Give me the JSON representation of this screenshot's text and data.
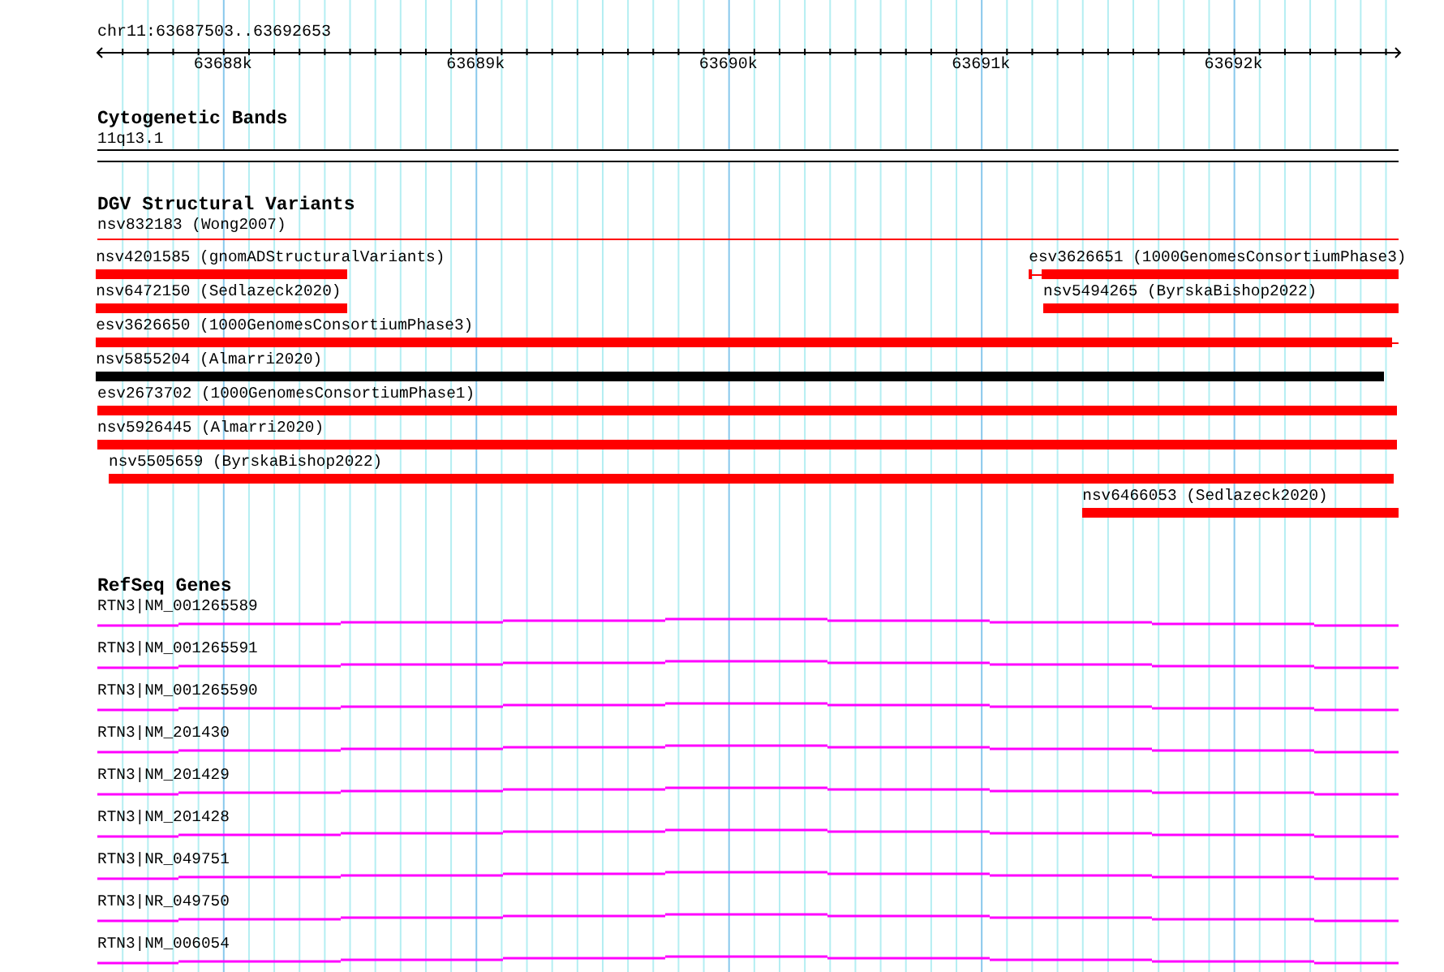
{
  "ruler": {
    "region": "chr11:63687503..63692653",
    "ticks": [
      {
        "label": "63688k"
      },
      {
        "label": "63689k"
      },
      {
        "label": "63690k"
      },
      {
        "label": "63691k"
      },
      {
        "label": "63692k"
      }
    ]
  },
  "tracks": [
    {
      "kind": "bands",
      "title": "Cytogenetic Bands",
      "rows": [
        {
          "features": [
            {
              "kind": "band",
              "label": "11q13.1"
            }
          ]
        }
      ]
    },
    {
      "kind": "variants",
      "title": "DGV Structural Variants",
      "rows": [
        {
          "features": [
            {
              "kind": "line",
              "label": "nsv832183 (Wong2007)",
              "color": "#ff0000"
            }
          ]
        },
        {
          "features": [
            {
              "kind": "bar",
              "label": "nsv4201585 (gnomADStructuralVariants)",
              "color": "#ff0000"
            },
            {
              "kind": "bar",
              "label": "esv3626651 (1000GenomesConsortiumPhase3)",
              "color": "#ff0000"
            }
          ]
        },
        {
          "features": [
            {
              "kind": "bar",
              "label": "nsv6472150 (Sedlazeck2020)",
              "color": "#ff0000"
            },
            {
              "kind": "bar",
              "label": "nsv5494265 (ByrskaBishop2022)",
              "color": "#ff0000"
            }
          ]
        },
        {
          "features": [
            {
              "kind": "bar",
              "label": "esv3626650 (1000GenomesConsortiumPhase3)",
              "color": "#ff0000"
            }
          ]
        },
        {
          "features": [
            {
              "kind": "bar",
              "label": "nsv5855204 (Almarri2020)",
              "color": "#000000"
            }
          ]
        },
        {
          "features": [
            {
              "kind": "bar",
              "label": "esv2673702 (1000GenomesConsortiumPhase1)",
              "color": "#ff0000"
            }
          ]
        },
        {
          "features": [
            {
              "kind": "bar",
              "label": "nsv5926445 (Almarri2020)",
              "color": "#ff0000"
            }
          ]
        },
        {
          "features": [
            {
              "kind": "bar",
              "label": "nsv5505659 (ByrskaBishop2022)",
              "color": "#ff0000"
            }
          ]
        },
        {
          "features": [
            {
              "kind": "bar",
              "label": "nsv6466053 (Sedlazeck2020)",
              "color": "#ff0000"
            }
          ]
        }
      ]
    },
    {
      "kind": "genes",
      "title": "RefSeq Genes",
      "rows": [
        {
          "features": [
            {
              "kind": "gene",
              "label": "RTN3|NM_001265589"
            }
          ]
        },
        {
          "features": [
            {
              "kind": "gene",
              "label": "RTN3|NM_001265591"
            }
          ]
        },
        {
          "features": [
            {
              "kind": "gene",
              "label": "RTN3|NM_001265590"
            }
          ]
        },
        {
          "features": [
            {
              "kind": "gene",
              "label": "RTN3|NM_201430"
            }
          ]
        },
        {
          "features": [
            {
              "kind": "gene",
              "label": "RTN3|NM_201429"
            }
          ]
        },
        {
          "features": [
            {
              "kind": "gene",
              "label": "RTN3|NM_201428"
            }
          ]
        },
        {
          "features": [
            {
              "kind": "gene",
              "label": "RTN3|NR_049751"
            }
          ]
        },
        {
          "features": [
            {
              "kind": "gene",
              "label": "RTN3|NR_049750"
            }
          ]
        },
        {
          "features": [
            {
              "kind": "gene",
              "label": "RTN3|NM_006054"
            }
          ]
        }
      ]
    }
  ]
}
